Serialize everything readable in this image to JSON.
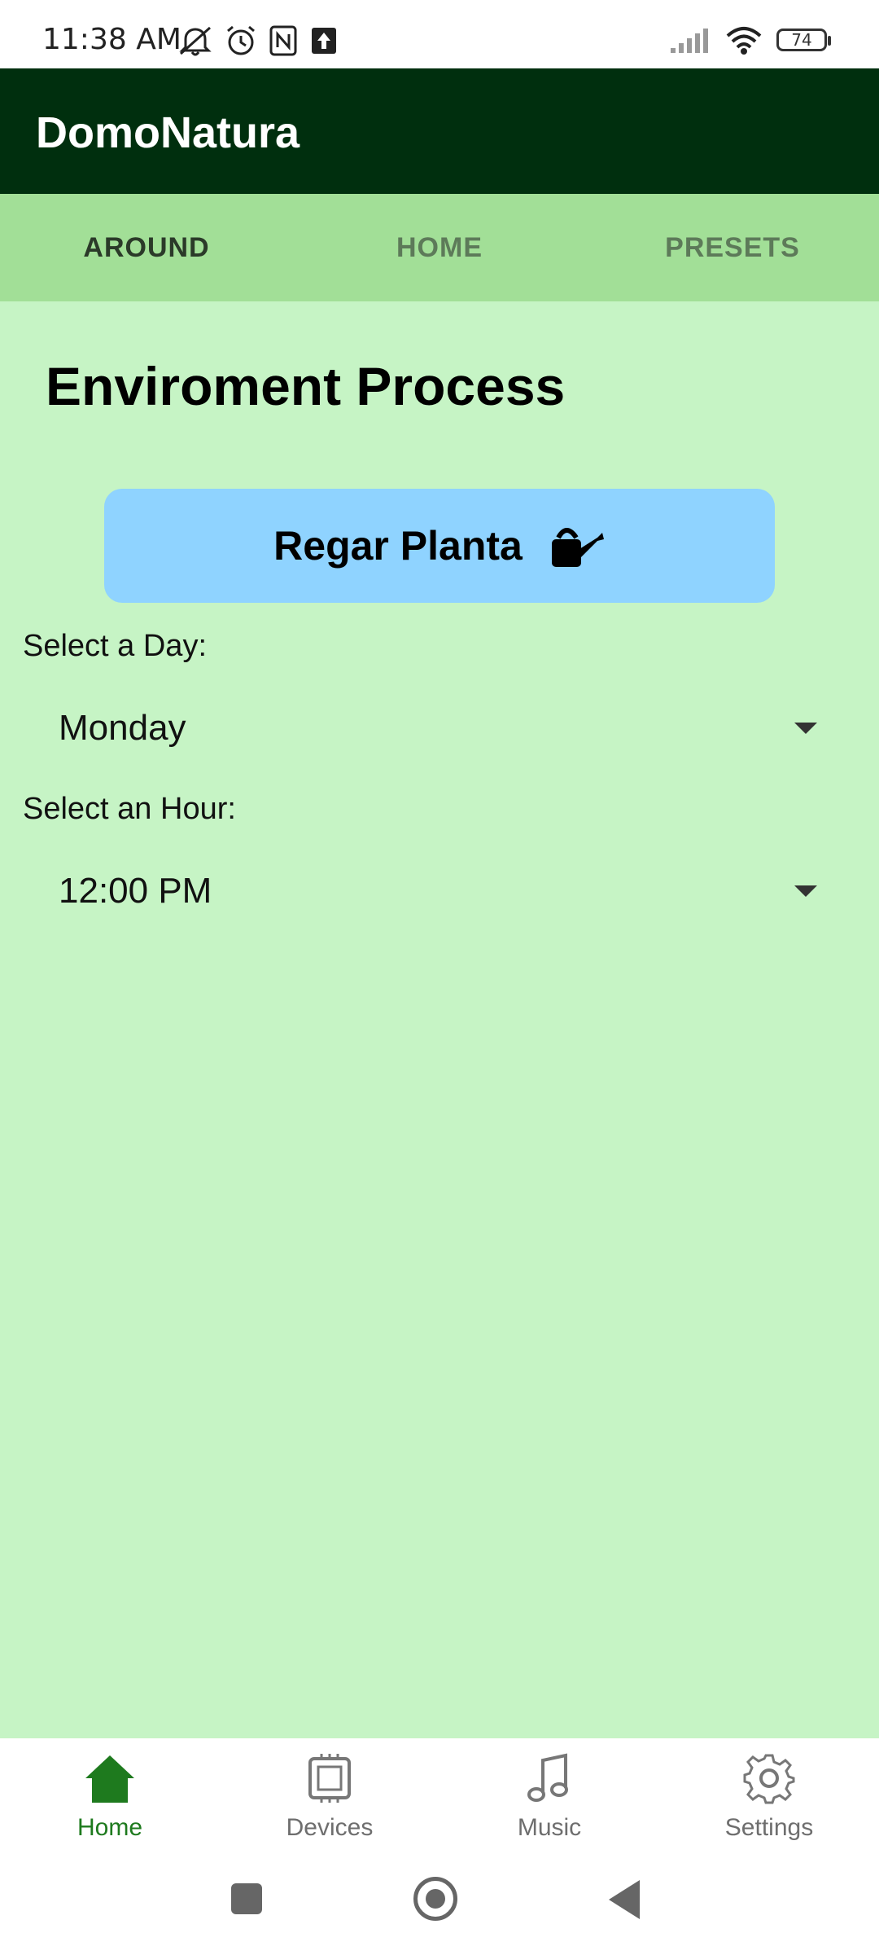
{
  "status_bar": {
    "time": "11:38 AM",
    "battery": "74",
    "left_icons": [
      "mute-icon",
      "alarm-icon",
      "nfc-icon",
      "upload-icon"
    ],
    "right_icons": [
      "signal-icon",
      "wifi-icon",
      "battery-icon"
    ]
  },
  "app_bar": {
    "title": "DomoNatura"
  },
  "tabs": [
    {
      "label": "AROUND",
      "active": true
    },
    {
      "label": "HOME",
      "active": false
    },
    {
      "label": "PRESETS",
      "active": false
    }
  ],
  "main": {
    "title": "Enviroment Process",
    "water_button": {
      "label": "Regar Planta",
      "icon": "watering-can-icon"
    },
    "day": {
      "label": "Select a Day:",
      "value": "Monday"
    },
    "hour": {
      "label": "Select an Hour:",
      "value": "12:00 PM"
    }
  },
  "bottom_nav": [
    {
      "label": "Home",
      "icon": "home-icon",
      "active": true
    },
    {
      "label": "Devices",
      "icon": "chip-icon",
      "active": false
    },
    {
      "label": "Music",
      "icon": "music-note-icon",
      "active": false
    },
    {
      "label": "Settings",
      "icon": "gear-icon",
      "active": false
    }
  ],
  "colors": {
    "app_bar": "#002f0e",
    "tabs": "#a2df97",
    "content_bg": "#c6f4c5",
    "button": "#8fd3ff",
    "nav_active": "#1e7a1e"
  }
}
